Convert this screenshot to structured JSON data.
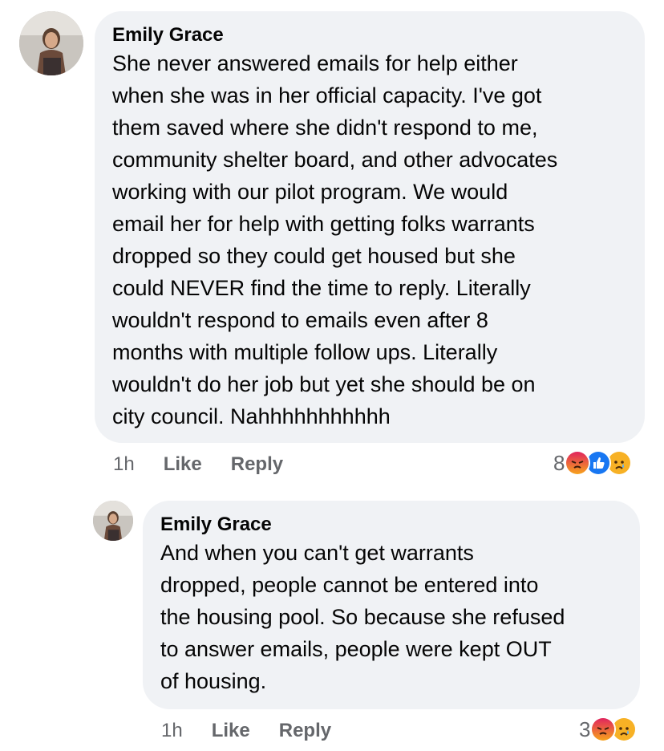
{
  "comments": [
    {
      "author": "Emily Grace",
      "text": "She never answered emails for help either\nwhen she was in her official capacity. I've got\nthem saved where she didn't respond to me,\ncommunity shelter board, and other advocates\nworking with our pilot program. We would\nemail her for help with getting folks warrants\ndropped so they could get housed but she\ncould NEVER find the time to reply. Literally\nwouldn't respond to emails even after 8\nmonths with multiple follow ups. Literally\nwouldn't do her job but yet she should be on\ncity council. Nahhhhhhhhhhh",
      "time": "1h",
      "like_label": "Like",
      "reply_label": "Reply",
      "reaction_count": "8",
      "reactions": [
        "angry",
        "like",
        "sad"
      ]
    },
    {
      "author": "Emily Grace",
      "text": "And when you can't get warrants\ndropped, people cannot be entered into\nthe housing pool. So because she refused\nto answer emails, people were kept OUT\nof housing.",
      "time": "1h",
      "like_label": "Like",
      "reply_label": "Reply",
      "reaction_count": "3",
      "reactions": [
        "angry",
        "sad"
      ]
    }
  ],
  "colors": {
    "bubble": "#f0f2f5",
    "meta": "#65676b",
    "like_blue": "#1877f2",
    "angry": "#e9710f",
    "sad": "#f7b125"
  }
}
